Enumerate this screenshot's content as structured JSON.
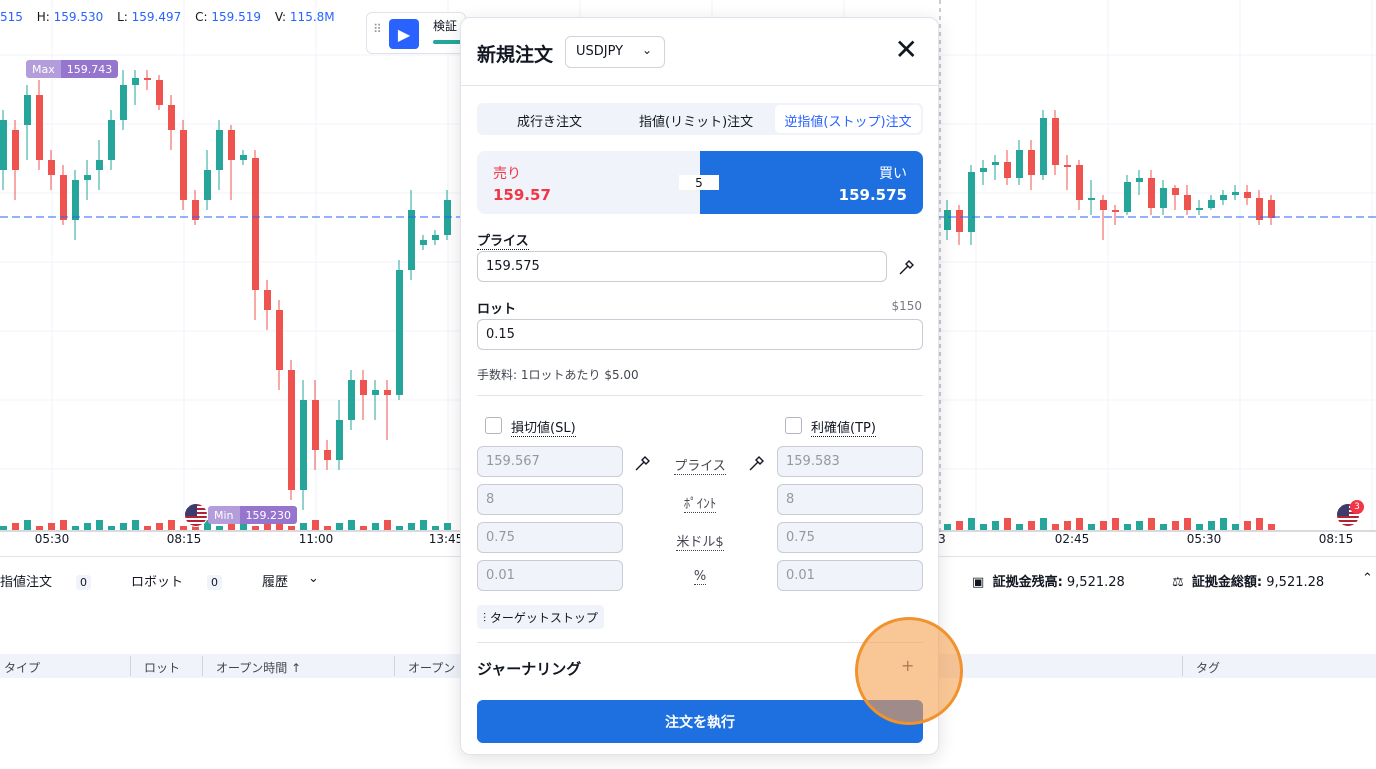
{
  "ohlc": {
    "o_tail": "515",
    "h_label": "H:",
    "h": "159.530",
    "l_label": "L:",
    "l": "159.497",
    "c_label": "C:",
    "c": "159.519",
    "v_label": "V:",
    "v": "115.8M"
  },
  "chart": {
    "max_tag": {
      "label": "Max",
      "value": "159.743"
    },
    "min_tag": {
      "label": "Min",
      "value": "159.230"
    },
    "time_labels": [
      "05:30",
      "08:15",
      "11:00",
      "13:45",
      "3",
      "02:45",
      "05:30",
      "08:15"
    ],
    "notif_count": "3",
    "colors": {
      "up": "#26a69a",
      "down": "#ef5350",
      "price_line": "#2962ff"
    }
  },
  "replay": {
    "label": "検証"
  },
  "bottom": {
    "tabs": [
      {
        "label": "指値注文",
        "count": "0"
      },
      {
        "label": "ロボット",
        "count": "0"
      },
      {
        "label": "履歴",
        "count": ""
      }
    ],
    "balance_label": "証拠金残高:",
    "balance": "9,521.28",
    "equity_label": "証拠金総額:",
    "equity": "9,521.28",
    "columns": [
      "タイプ",
      "ロット",
      "オープン時間 ↑",
      "オープン",
      "タグ"
    ]
  },
  "order": {
    "title": "新規注文",
    "symbol": "USDJPY",
    "tabs": [
      "成行き注文",
      "指値(リミット)注文",
      "逆指値(ストップ)注文"
    ],
    "sell_label": "売り",
    "sell_price": "159.57",
    "buy_label": "買い",
    "buy_price": "159.575",
    "spread": "5",
    "price_label": "プライス",
    "price_value": "159.575",
    "lot_label": "ロット",
    "lot_cost": "$150",
    "lot_value": "0.15",
    "commission_label": "手数料:",
    "commission_text": "1ロットあたり $5.00",
    "sl_label": "損切値(SL)",
    "tp_label": "利確値(TP)",
    "mid_labels": [
      "プライス",
      "ﾎﾟｲﾝﾄ",
      "米ドル$",
      "%"
    ],
    "sl_values": [
      "159.567",
      "8",
      "0.75",
      "0.01"
    ],
    "tp_values": [
      "159.583",
      "8",
      "0.75",
      "0.01"
    ],
    "trailing_label": "ターゲットストップ",
    "journal_label": "ジャーナリング",
    "submit_label": "注文を執行"
  }
}
